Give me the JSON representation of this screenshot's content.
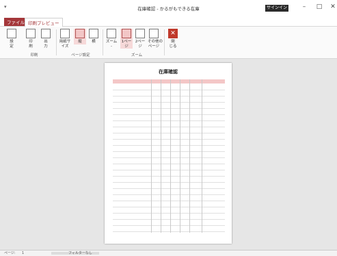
{
  "title": "在庫確認 - かるがもできる在庫",
  "sign_in": "サインイン",
  "tabs": {
    "file": "ファイル",
    "print_preview": "印刷プレビュー"
  },
  "ribbon": {
    "setup": "設\n定",
    "print": "印\n刷",
    "output": "出\n力",
    "size": "用紙サ\nイズ",
    "portrait": "縦",
    "landscape": "横",
    "zoom": "ズーム\n-",
    "one_page": "1ペー\nジ",
    "two_page": "2ペー\nジ",
    "other": "その他の\nページ",
    "close": "閉\nじる",
    "group_print": "印刷",
    "group_page": "ページ設定",
    "group_zoom": "ズーム"
  },
  "report": {
    "title": "在庫確認",
    "rows": 24
  },
  "status": {
    "page_label": "ページ:",
    "page_num": "1",
    "filter": "フィルターなし"
  }
}
